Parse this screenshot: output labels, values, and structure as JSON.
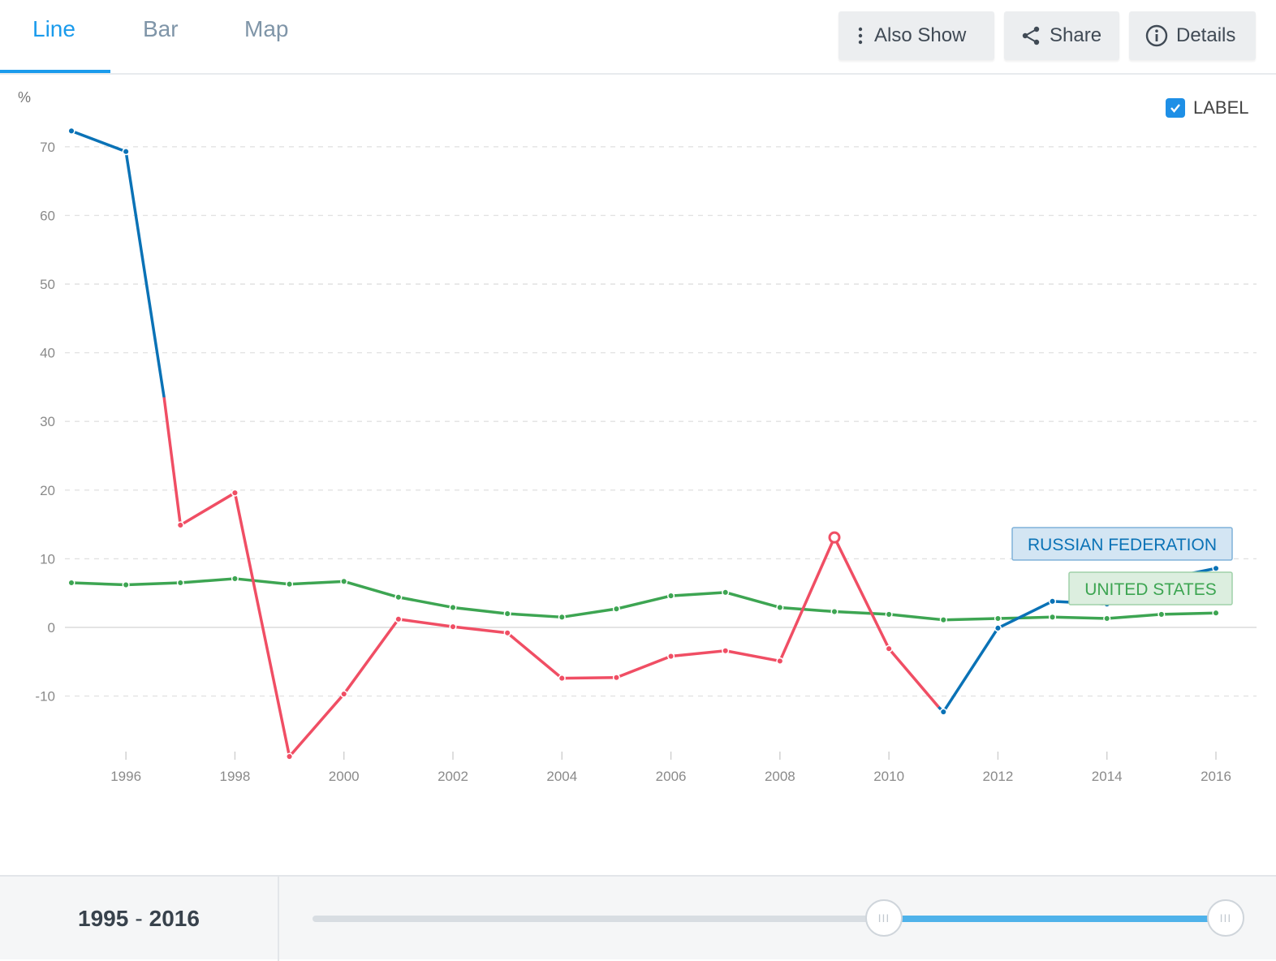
{
  "tabs": [
    {
      "label": "Line",
      "active": true
    },
    {
      "label": "Bar",
      "active": false
    },
    {
      "label": "Map",
      "active": false
    }
  ],
  "buttons": {
    "also_show": "Also Show",
    "share": "Share",
    "details": "Details"
  },
  "icons": [
    "vertical-dots-icon",
    "share-icon",
    "info-icon",
    "checkmark-icon"
  ],
  "label_toggle": {
    "text": "LABEL",
    "checked": true
  },
  "range": {
    "start": "1995",
    "sep": "-",
    "end": "2016"
  },
  "slider": {
    "start_fraction": 0.62,
    "end_fraction": 1.0
  },
  "colors": {
    "accent": "#1a9bec",
    "russia_blue": "#0a72b6",
    "russia_red": "#f04e64",
    "us_green": "#3da552"
  },
  "chart_data": {
    "type": "line",
    "unit": "%",
    "xlim": [
      1995,
      2016
    ],
    "ylim": [
      -19,
      75
    ],
    "yticks": [
      70,
      60,
      50,
      40,
      30,
      20,
      10,
      0,
      -10
    ],
    "xticks": [
      1996,
      1998,
      2000,
      2002,
      2004,
      2006,
      2008,
      2010,
      2012,
      2014,
      2016
    ],
    "grid": true,
    "series": [
      {
        "name": "RUSSIAN FEDERATION",
        "x": [
          1995,
          1996,
          1997,
          1998,
          1999,
          2000,
          2001,
          2002,
          2003,
          2004,
          2005,
          2006,
          2007,
          2008,
          2009,
          2010,
          2011,
          2012,
          2013,
          2014,
          2015,
          2016
        ],
        "values": [
          72.3,
          69.3,
          14.9,
          19.6,
          -18.8,
          -9.7,
          1.2,
          0.1,
          -0.8,
          -7.4,
          -7.3,
          -4.2,
          -3.4,
          -4.9,
          13.1,
          -3.1,
          -12.3,
          -0.1,
          3.8,
          3.4,
          7.0,
          8.6
        ],
        "label": "RUSSIAN FEDERATION"
      },
      {
        "name": "UNITED STATES",
        "x": [
          1995,
          1996,
          1997,
          1998,
          1999,
          2000,
          2001,
          2002,
          2003,
          2004,
          2005,
          2006,
          2007,
          2008,
          2009,
          2010,
          2011,
          2012,
          2013,
          2014,
          2015,
          2016
        ],
        "values": [
          6.5,
          6.2,
          6.5,
          7.1,
          6.3,
          6.7,
          4.4,
          2.9,
          2.0,
          1.5,
          2.7,
          4.6,
          5.1,
          2.9,
          2.3,
          1.9,
          1.1,
          1.3,
          1.5,
          1.3,
          1.9,
          2.1
        ],
        "label": "UNITED STATES"
      }
    ]
  }
}
